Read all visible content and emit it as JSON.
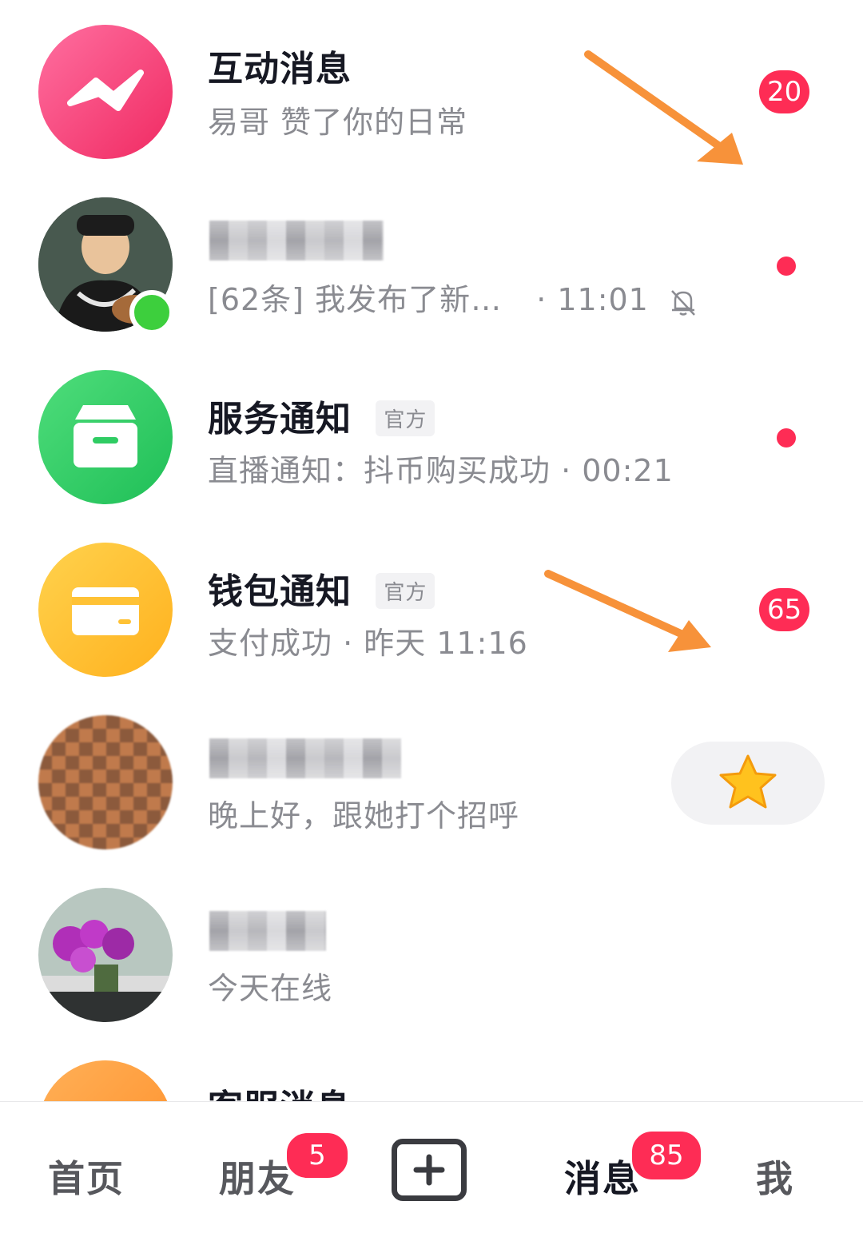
{
  "rows": [
    {
      "title": "互动消息",
      "subtitle": "易哥 赞了你的日常",
      "badge": "20"
    },
    {
      "subtitle_main": "[62条] 我发布了新…",
      "subtitle_time": "· 11:01"
    },
    {
      "title": "服务通知",
      "tag": "官方",
      "subtitle": "直播通知：抖币购买成功 · 00:21"
    },
    {
      "title": "钱包通知",
      "tag": "官方",
      "subtitle": "支付成功 · 昨天 11:16",
      "badge": "65"
    },
    {
      "subtitle": "晚上好，跟她打个招呼"
    },
    {
      "subtitle": "今天在线"
    },
    {
      "title": "客服消息"
    }
  ],
  "nav": {
    "home": "首页",
    "friends": "朋友",
    "friends_badge": "5",
    "messages": "消息",
    "messages_badge": "85",
    "me": "我"
  },
  "colors": {
    "accent_red": "#fe2c55",
    "arrow_orange": "#f7923a",
    "interactive_pink": "#f5467f",
    "service_green": "#2ecc63",
    "wallet_yellow": "#ffc235"
  }
}
